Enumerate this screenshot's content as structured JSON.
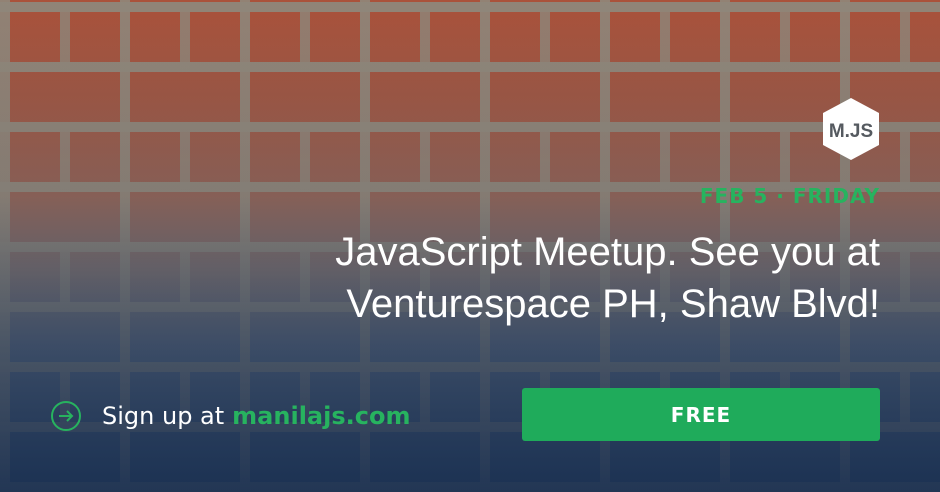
{
  "logo": {
    "text": "M.JS",
    "icon": "hexagon-logo"
  },
  "event": {
    "date": "FEB 5 · FRIDAY",
    "headline_line1": "JavaScript Meetup. See you at",
    "headline_line2": "Venturespace PH, Shaw Blvd!"
  },
  "signup": {
    "prefix": "Sign up at",
    "site": "manilajs.com",
    "icon": "arrow-circle-icon"
  },
  "cta": {
    "label": "FREE"
  },
  "colors": {
    "accent": "#27b35f",
    "button": "#1fab5b",
    "text": "#ffffff"
  }
}
